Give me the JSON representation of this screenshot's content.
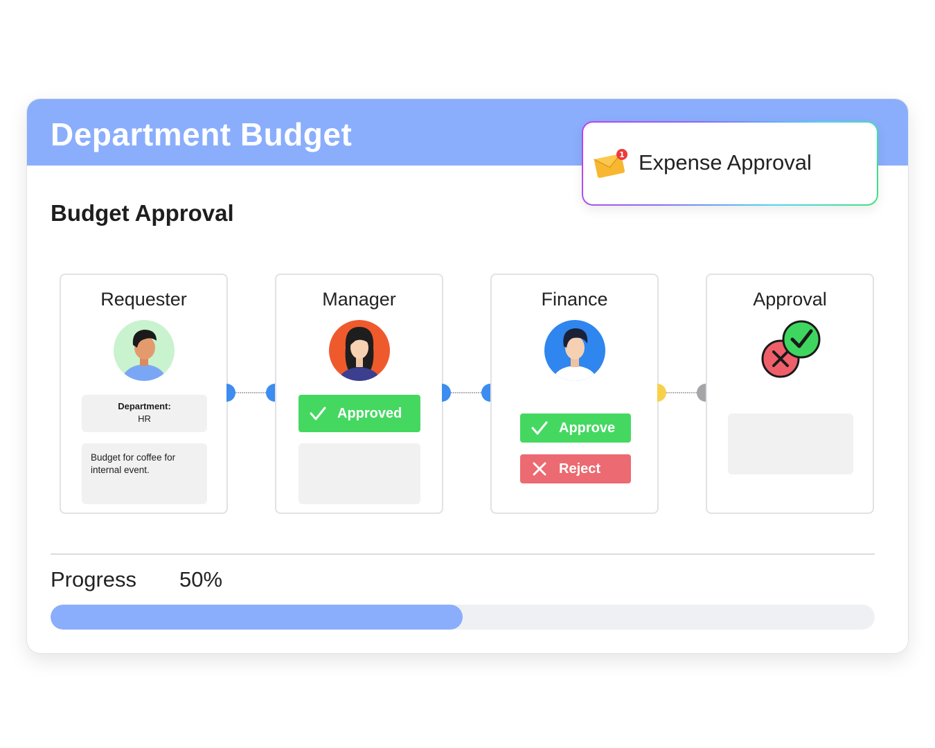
{
  "header": {
    "title": "Department Budget"
  },
  "notification": {
    "text": "Expense Approval",
    "badge": "1"
  },
  "section": {
    "title": "Budget Approval"
  },
  "steps": [
    {
      "title": "Requester",
      "department_label": "Department:",
      "department_value": "HR",
      "description": "Budget for coffee for internal event."
    },
    {
      "title": "Manager",
      "status_label": "Approved"
    },
    {
      "title": "Finance",
      "approve_label": "Approve",
      "reject_label": "Reject"
    },
    {
      "title": "Approval"
    }
  ],
  "progress": {
    "label": "Progress",
    "value_text": "50%",
    "fraction": 0.5
  },
  "colors": {
    "header": "#8aaefc",
    "approve": "#45d861",
    "reject": "#ec6a71",
    "connector_blue": "#3d8cf0",
    "connector_yellow": "#f7d14a",
    "connector_gray": "#a5a5a8"
  }
}
